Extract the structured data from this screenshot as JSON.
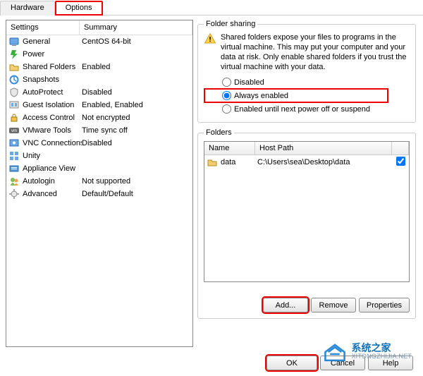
{
  "tabs": {
    "hardware": "Hardware",
    "options": "Options"
  },
  "left": {
    "col_settings": "Settings",
    "col_summary": "Summary",
    "rows": [
      {
        "icon": "general-icon",
        "label": "General",
        "summary": "CentOS 64-bit"
      },
      {
        "icon": "power-icon",
        "label": "Power",
        "summary": ""
      },
      {
        "icon": "shared-folders-icon",
        "label": "Shared Folders",
        "summary": "Enabled"
      },
      {
        "icon": "snapshots-icon",
        "label": "Snapshots",
        "summary": ""
      },
      {
        "icon": "autoprotect-icon",
        "label": "AutoProtect",
        "summary": "Disabled"
      },
      {
        "icon": "guest-isolation-icon",
        "label": "Guest Isolation",
        "summary": "Enabled, Enabled"
      },
      {
        "icon": "access-control-icon",
        "label": "Access Control",
        "summary": "Not encrypted"
      },
      {
        "icon": "vmware-tools-icon",
        "label": "VMware Tools",
        "summary": "Time sync off"
      },
      {
        "icon": "vnc-icon",
        "label": "VNC Connections",
        "summary": "Disabled"
      },
      {
        "icon": "unity-icon",
        "label": "Unity",
        "summary": ""
      },
      {
        "icon": "appliance-view-icon",
        "label": "Appliance View",
        "summary": ""
      },
      {
        "icon": "autologin-icon",
        "label": "Autologin",
        "summary": "Not supported"
      },
      {
        "icon": "advanced-icon",
        "label": "Advanced",
        "summary": "Default/Default"
      }
    ]
  },
  "sharing": {
    "legend": "Folder sharing",
    "warning": "Shared folders expose your files to programs in the virtual machine. This may put your computer and your data at risk. Only enable shared folders if you trust the virtual machine with your data.",
    "opt_disabled": "Disabled",
    "opt_always": "Always enabled",
    "opt_until": "Enabled until next power off or suspend"
  },
  "folders": {
    "legend": "Folders",
    "col_name": "Name",
    "col_hostpath": "Host Path",
    "rows": [
      {
        "name": "data",
        "hostpath": "C:\\Users\\sea\\Desktop\\data",
        "checked": true
      }
    ],
    "btn_add": "Add...",
    "btn_remove": "Remove",
    "btn_props": "Properties"
  },
  "dialog": {
    "ok": "OK",
    "cancel": "Cancel",
    "help": "Help"
  },
  "watermark": {
    "title": "系统之家",
    "url": "XITONGZHIJIA.NET"
  }
}
